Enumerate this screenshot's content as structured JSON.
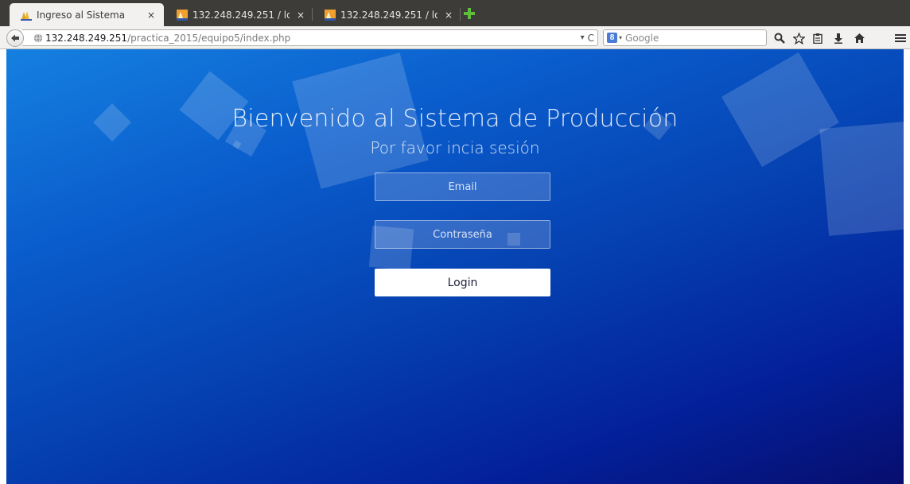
{
  "browser": {
    "tabs": [
      {
        "title": "Ingreso al Sistema",
        "close": "×",
        "active": true
      },
      {
        "title": "132.248.249.251 / lo…",
        "close": "×",
        "active": false
      },
      {
        "title": "132.248.249.251 / lo…",
        "close": "×",
        "active": false
      }
    ],
    "url": {
      "host": "132.248.249.251",
      "path": "/practica_2015/equipo5/index.php"
    },
    "url_controls": {
      "dropdown": "▾",
      "reload": "C"
    },
    "search": {
      "engine_badge": "8",
      "dropdown": "▾",
      "placeholder": "Google"
    },
    "icons": {
      "back": "back-arrow-icon",
      "site": "globe-icon",
      "new_tab": "plus-icon",
      "search": "magnifier-icon",
      "bookmark": "star-icon",
      "reading_list": "clipboard-icon",
      "downloads": "download-arrow-icon",
      "home": "home-icon",
      "menu": "hamburger-menu-icon"
    }
  },
  "page": {
    "heading": "Bienvenido al Sistema de Producción",
    "subheading": "Por favor incia sesión",
    "email_placeholder": "Email",
    "password_placeholder": "Contraseña",
    "login_label": "Login"
  },
  "colors": {
    "background_top": "#1580e0",
    "background_bottom": "#070e6e",
    "tabstrip": "#3d3c38",
    "toolbar": "#f2f1f0",
    "new_tab_green": "#5fbf3a"
  }
}
